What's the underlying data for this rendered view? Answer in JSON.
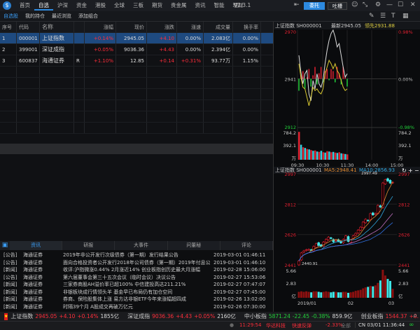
{
  "nav": {
    "items": [
      "首页",
      "自选",
      "沪深",
      "资金",
      "港股",
      "全球",
      "三板",
      "期货",
      "贵金属",
      "资讯",
      "智能",
      "理财"
    ],
    "active": 1,
    "version": "V2.3.1",
    "entrust": "委托",
    "feedback": "吐槽"
  },
  "subtabs": {
    "items": [
      "自选股",
      "我的持仓",
      "最近浏览",
      "添加组合"
    ],
    "active": 0
  },
  "table": {
    "headers": [
      "序号",
      "代码",
      "名称",
      "",
      "涨幅",
      "现价",
      "涨跌",
      "涨速",
      "成交量",
      "换手率"
    ],
    "rows": [
      [
        "1",
        "000001",
        "上证指数",
        "",
        "+0.14%",
        "2945.05",
        "+4.10",
        "0.00%",
        "2.083亿",
        "0.00%"
      ],
      [
        "2",
        "399001",
        "深证成指",
        "",
        "+0.05%",
        "9036.36",
        "+4.43",
        "0.00%",
        "2.394亿",
        "0.00%"
      ],
      [
        "3",
        "600837",
        "海通证券",
        "R",
        "+1.10%",
        "12.85",
        "+0.14",
        "+0.31%",
        "93.77万",
        "1.15%"
      ]
    ]
  },
  "news": {
    "tabs": [
      "资讯",
      "研报",
      "大事件",
      "问董秘",
      "评论"
    ],
    "active": 0,
    "items": [
      [
        "[公告]",
        "海通证券",
        "2019年非公开发行次级债券（第一期）发行结果公告",
        "2019-03-01 01:46:11"
      ],
      [
        "[公告]",
        "海通证券",
        "面向合格投资者公开发行2018年公司债券（第一期）2019年付息公",
        "2019-03-01 01:46:10"
      ],
      [
        "[新闻]",
        "海通证券",
        "收评:沪指微涨0.44% 2月涨近14% 创业板指创历史最大月涨幅",
        "2019-02-28 15:06:00"
      ],
      [
        "[公告]",
        "海通证券",
        "第六届董事会第三十五次会议（临时会议）决议公告",
        "2019-02-27 15:53:06"
      ],
      [
        "[新闻]",
        "海通证券",
        "三家券商股AH溢价率已超100% 中信建投高达211.21%",
        "2019-02-27 07:47:07"
      ],
      [
        "[新闻]",
        "海通证券",
        "非银板块成行情领头羊 基金早已布局仍有加仓空间",
        "2019-02-27 07:45:00"
      ],
      [
        "[新闻]",
        "海通证券",
        "券商、保险股集体上涨 易方达非银ETF今年来涨幅超四成",
        "2019-02-26 13:02:00"
      ],
      [
        "[新闻]",
        "海通证券",
        "时隔39个月 A股成交再破万亿元",
        "2019-02-26 07:30:00"
      ]
    ]
  },
  "index_bar": [
    {
      "name": "上证指数",
      "price": "2945.05",
      "chg": "+4.10",
      "pct": "+0.14%",
      "amt": "1855亿",
      "dir": "up"
    },
    {
      "name": "深证成指",
      "price": "9036.36",
      "chg": "+4.43",
      "pct": "+0.05%",
      "amt": "2160亿",
      "dir": "up"
    },
    {
      "name": "中小板指",
      "price": "5871.24",
      "chg": "-22.45",
      "pct": "-0.38%",
      "amt": "859.9亿",
      "dir": "dn"
    },
    {
      "name": "创业板指",
      "price": "1544.37",
      "chg": "+0.",
      "pct": "",
      "amt": "",
      "dir": "up"
    }
  ],
  "status": {
    "time": "11:29:54",
    "stock": "华达科技",
    "event": "快速反弹",
    "pct": "-2.33%",
    "all": "全部",
    "clock": "CN 03/01 11:36:44"
  },
  "chart_data": [
    {
      "type": "line",
      "title": "上证指数 SH000001",
      "latest": "最新2945.05",
      "lead": "领先2931.88",
      "ylim": [
        2912,
        2970
      ],
      "y_labels": [
        "2970",
        "2941",
        "2912"
      ],
      "pct_labels": [
        "0.98%",
        "0.00%",
        "-0.98%"
      ],
      "x_labels": [
        "09:30",
        "10:30",
        "11:30",
        "14:00",
        "15:00"
      ],
      "vol_labels": [
        "784.2",
        "392.1",
        "万"
      ],
      "vol_max": 784.2,
      "price": [
        2955,
        2945,
        2938,
        2944,
        2946,
        2932,
        2928,
        2940,
        2935,
        2944,
        2938,
        2936,
        2940,
        2950,
        2958,
        2964,
        2968,
        2970,
        2966,
        2960,
        2962,
        2955,
        2948,
        2942,
        2944
      ],
      "avg": [
        2950,
        2942,
        2936,
        2935,
        2930,
        2925,
        2930,
        2936,
        2934,
        2935,
        2933,
        2932,
        2935,
        2944,
        2948,
        2952,
        2950,
        2947,
        2950,
        2946,
        2944,
        2940,
        2936,
        2934,
        2935
      ],
      "volume": [
        780,
        420,
        350,
        330,
        300,
        290,
        270,
        250,
        260,
        230,
        220,
        250,
        210,
        200,
        240,
        230,
        210,
        220,
        200,
        190,
        210,
        180,
        170,
        160,
        150
      ]
    },
    {
      "type": "candlestick",
      "title": "上证指数 SH000001",
      "ma5": "MA5:2948.41",
      "ma10": "MA10:2856.93",
      "ylim": [
        2441,
        2997
      ],
      "y_labels": [
        "2997",
        "2812",
        "2626",
        "2441"
      ],
      "high_label": "2997.49",
      "low_label": "2440.91",
      "x_labels": [
        "2019/01",
        "02",
        "03"
      ],
      "vol_labels": [
        "5.66",
        "2.83",
        "亿"
      ],
      "vol_max": 5.66,
      "close": [
        2465,
        2514,
        2526,
        2533,
        2535,
        2530,
        2553,
        2570,
        2559,
        2554,
        2580,
        2596,
        2610,
        2602,
        2581,
        2591,
        2584,
        2575,
        2596,
        2618,
        2584,
        2594,
        2618,
        2633,
        2653,
        2671,
        2702,
        2719,
        2711,
        2754,
        2746,
        2754,
        2804,
        2794,
        2941,
        2961,
        2953,
        2940,
        2945
      ],
      "volume": [
        1.2,
        1.3,
        1.2,
        1.3,
        1.2,
        1.1,
        1.3,
        1.3,
        1.2,
        1.1,
        1.2,
        1.3,
        1.2,
        1.1,
        1.2,
        1.2,
        1.1,
        1.1,
        1.2,
        1.2,
        1.0,
        1.1,
        1.2,
        1.4,
        1.5,
        1.6,
        1.9,
        2.1,
        2.2,
        2.4,
        2.3,
        2.5,
        3.0,
        3.5,
        5.66,
        4.5,
        3.8,
        3.4,
        1.8
      ]
    }
  ]
}
